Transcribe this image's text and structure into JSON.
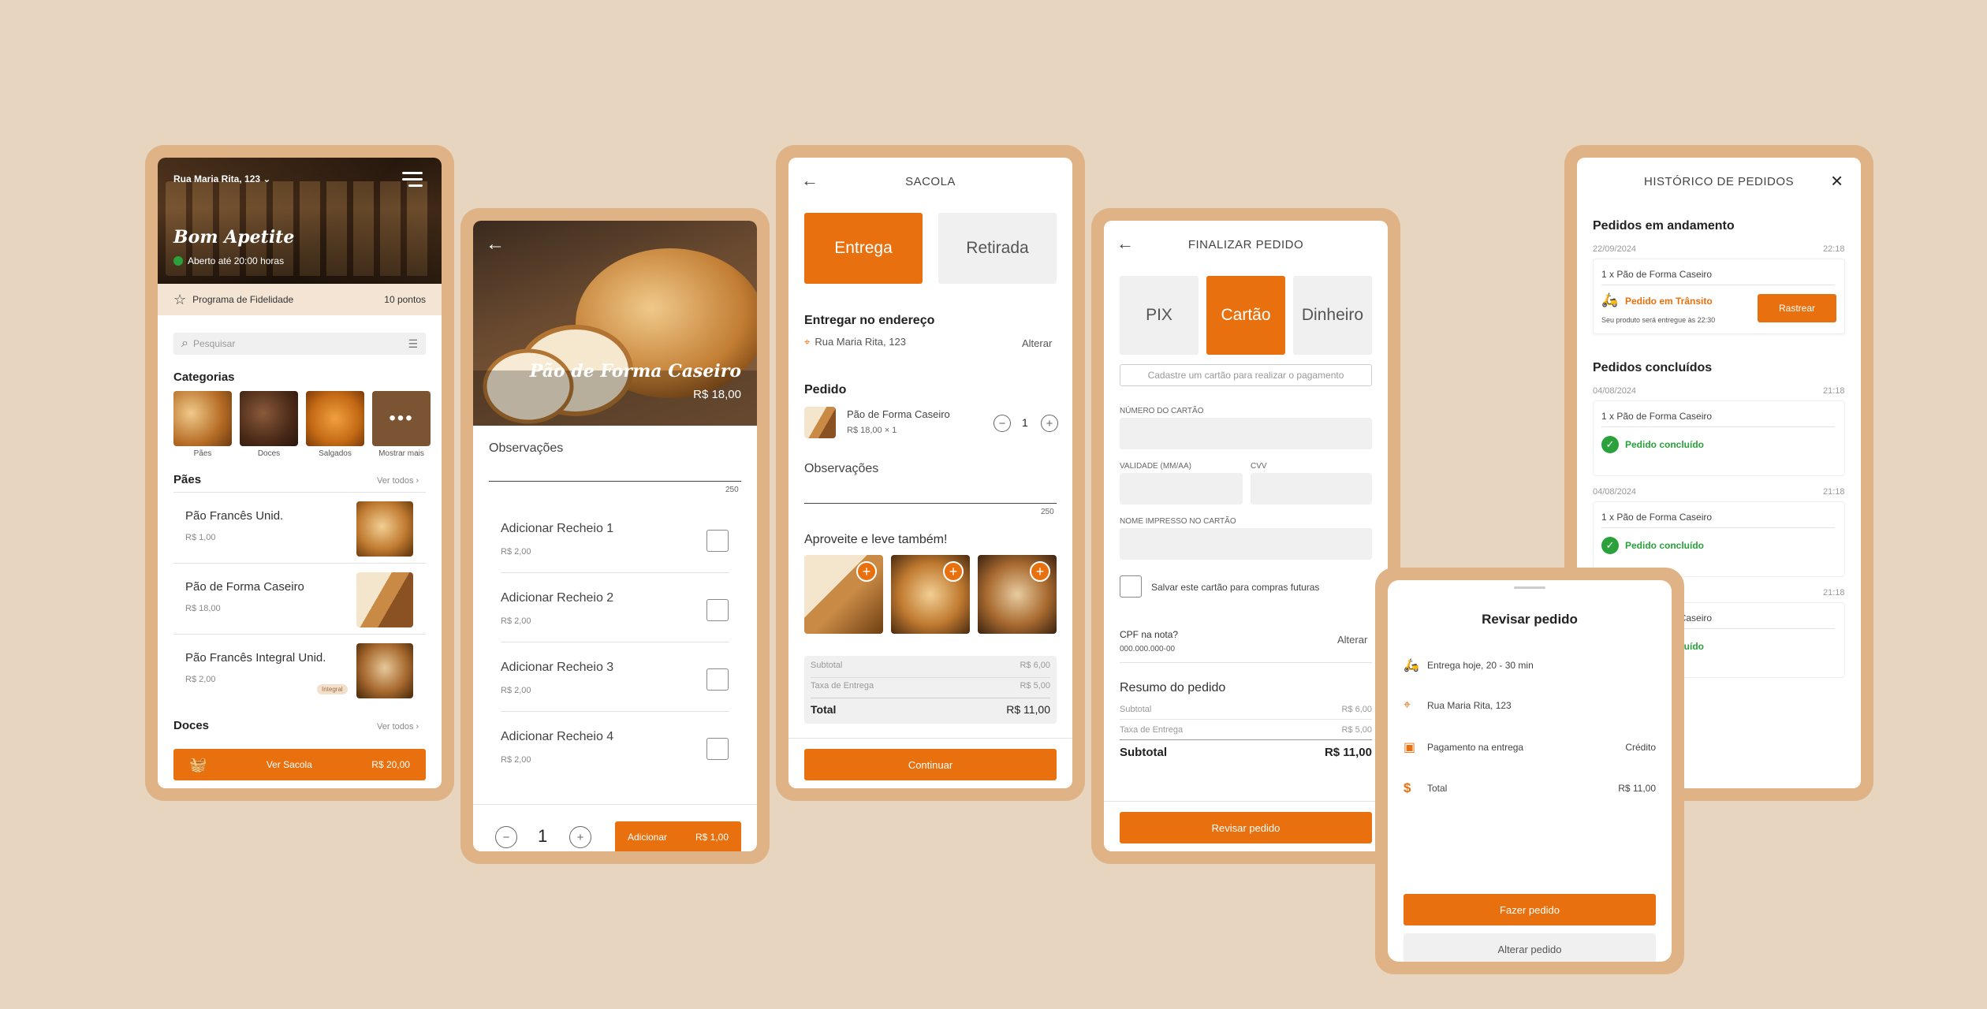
{
  "screen1": {
    "address": "Rua Maria Rita, 123",
    "store_name": "Bom Apetite",
    "open_status": "Aberto até 20:00 horas",
    "loyalty_label": "Programa de Fidelidade",
    "loyalty_points": "10 pontos",
    "search_placeholder": "Pesquisar",
    "categories_title": "Categorias",
    "categories": [
      {
        "label": "Pães"
      },
      {
        "label": "Doces"
      },
      {
        "label": "Salgados"
      },
      {
        "label": "Mostrar mais"
      }
    ],
    "section_paes": "Pães",
    "see_all": "Ver todos",
    "products": [
      {
        "name": "Pão Francês Unid.",
        "price": "R$ 1,00",
        "badge": ""
      },
      {
        "name": "Pão de Forma Caseiro",
        "price": "R$ 18,00",
        "badge": ""
      },
      {
        "name": "Pão Francês Integral Unid.",
        "price": "R$ 2,00",
        "badge": "Integral"
      }
    ],
    "section_doces": "Doces",
    "see_all_2": "Ver todos",
    "bag_label": "Ver Sacola",
    "bag_total": "R$ 20,00"
  },
  "screen2": {
    "product_name": "Pão de Forma Caseiro",
    "product_price": "R$ 18,00",
    "obs_title": "Observações",
    "obs_count": "250",
    "fillings": [
      {
        "label": "Adicionar Recheio 1",
        "price": "R$ 2,00"
      },
      {
        "label": "Adicionar Recheio 2",
        "price": "R$ 2,00"
      },
      {
        "label": "Adicionar Recheio 3",
        "price": "R$ 2,00"
      },
      {
        "label": "Adicionar Recheio 4",
        "price": "R$ 2,00"
      }
    ],
    "qty": "1",
    "add_label": "Adicionar",
    "add_price": "R$ 1,00"
  },
  "screen3": {
    "title": "SACOLA",
    "tab_delivery": "Entrega",
    "tab_pickup": "Retirada",
    "deliver_to": "Entregar no endereço",
    "address": "Rua Maria Rita, 123",
    "change": "Alterar",
    "order_title": "Pedido",
    "item_name": "Pão de Forma Caseiro",
    "item_price": "R$ 18,00 × 1",
    "item_qty": "1",
    "obs_title": "Observações",
    "obs_count": "250",
    "upsell_title": "Aproveite e leve também!",
    "subtotal_label": "Subtotal",
    "subtotal": "R$ 6,00",
    "fee_label": "Taxa de Entrega",
    "fee": "R$ 5,00",
    "total_label": "Total",
    "total": "R$ 11,00",
    "continue": "Continuar"
  },
  "screen4": {
    "title": "FINALIZAR PEDIDO",
    "pay_pix": "PIX",
    "pay_card": "Cartão",
    "pay_cash": "Dinheiro",
    "card_hint": "Cadastre um cartão para realizar o pagamento",
    "card_number_label": "NÚMERO DO CARTÃO",
    "expiry_label": "VALIDADE (MM/AA)",
    "cvv_label": "CVV",
    "name_label": "NOME IMPRESSO NO CARTÃO",
    "save_card": "Salvar este cartão para compras futuras",
    "cpf_title": "CPF na nota?",
    "cpf_value": "000.000.000-00",
    "change": "Alterar",
    "summary_title": "Resumo do pedido",
    "subtotal_label": "Subtotal",
    "subtotal": "R$ 6,00",
    "fee_label": "Taxa de Entrega",
    "fee": "R$ 5,00",
    "total_label": "Subtotal",
    "total": "R$ 11,00",
    "review_btn": "Revisar pedido"
  },
  "screen5": {
    "title": "Revisar pedido",
    "delivery_time": "Entrega hoje, 20 - 30 min",
    "address": "Rua Maria Rita, 123",
    "payment_label": "Pagamento na entrega",
    "payment_value": "Crédito",
    "total_label": "Total",
    "total": "R$ 11,00",
    "place_order": "Fazer pedido",
    "change_order": "Alterar pedido"
  },
  "screen6": {
    "title": "HISTÓRICO DE PEDIDOS",
    "in_progress_title": "Pedidos em andamento",
    "current": {
      "date": "22/09/2024",
      "time": "22:18",
      "item": "1 x Pão de Forma Caseiro",
      "status": "Pedido em Trânsito",
      "eta": "Seu produto será entregue às 22:30",
      "track": "Rastrear"
    },
    "done_title": "Pedidos concluídos",
    "done": [
      {
        "date": "04/08/2024",
        "time": "21:18",
        "item": "1 x Pão de Forma Caseiro",
        "status": "Pedido concluído"
      },
      {
        "date": "04/08/2024",
        "time": "21:18",
        "item": "1 x Pão de Forma Caseiro",
        "status": "Pedido concluído"
      },
      {
        "date": "",
        "time": "21:18",
        "item": "1 x Pão de Forma Caseiro",
        "status": "Pedido concluído"
      }
    ]
  },
  "colors": {
    "accent": "#e8700e",
    "frame": "#dfb385",
    "background": "#e8d5bf",
    "success": "#2aa13a"
  }
}
